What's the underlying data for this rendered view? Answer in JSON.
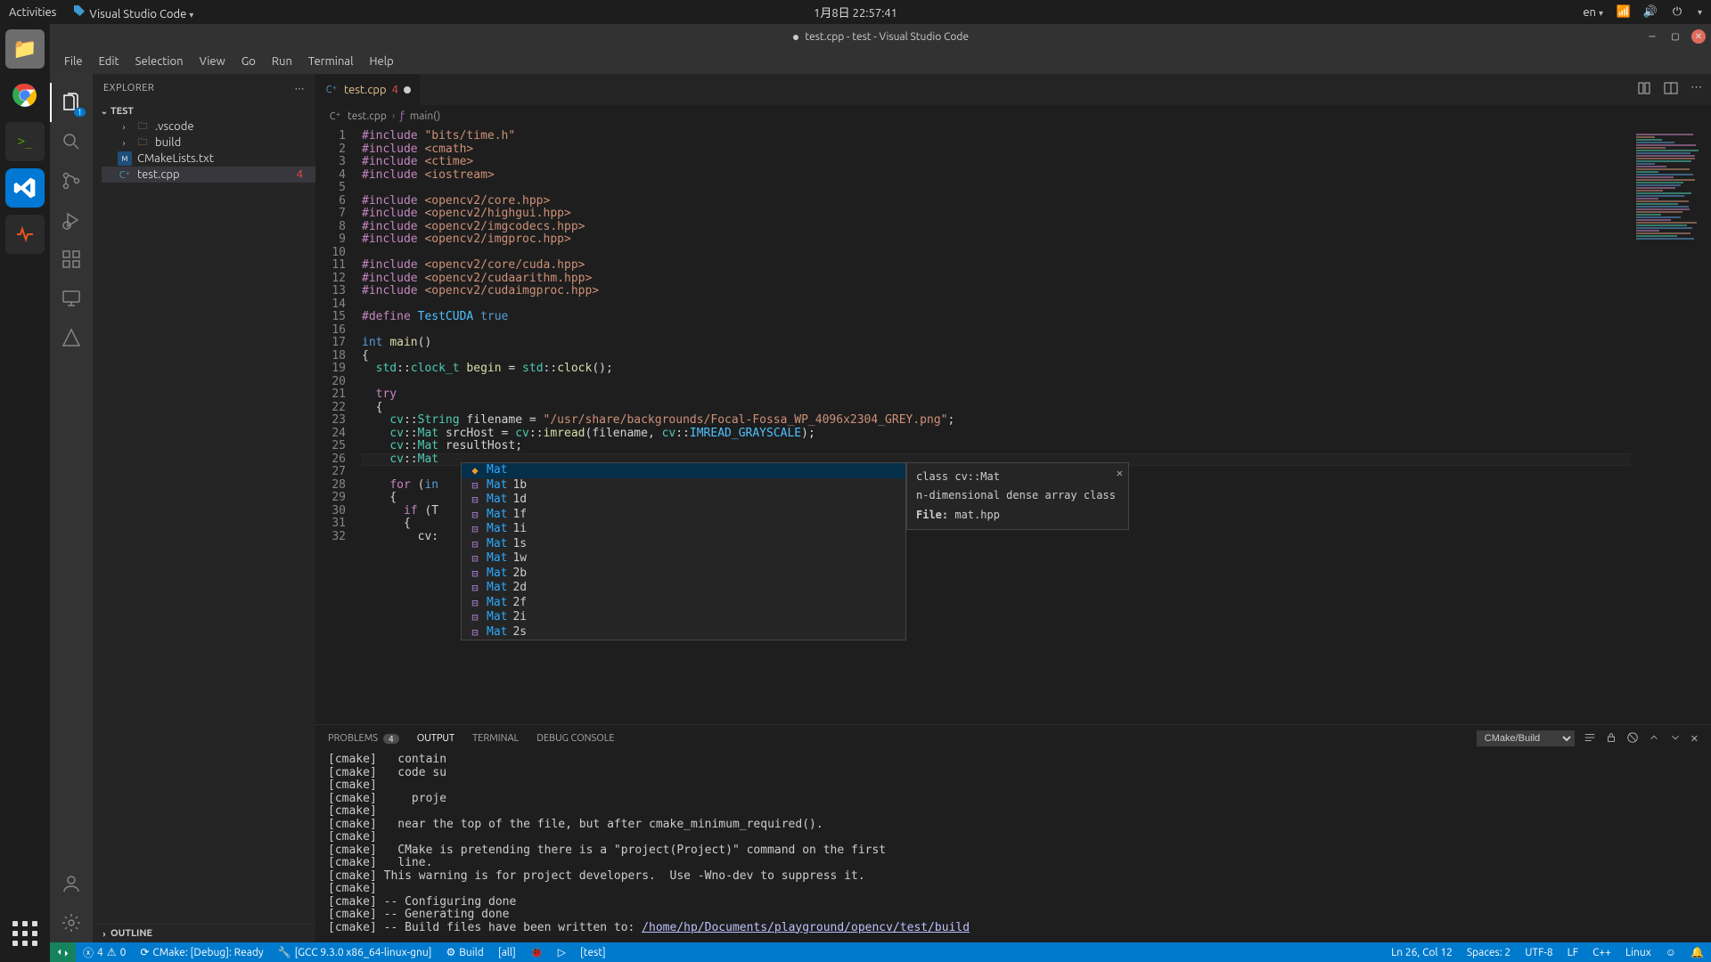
{
  "gnome": {
    "activities": "Activities",
    "app": "Visual Studio Code",
    "clock": "1月8日 22:57:41",
    "lang": "en"
  },
  "window": {
    "title_dirty": "●",
    "title": "test.cpp - test - Visual Studio Code"
  },
  "menu": [
    "File",
    "Edit",
    "Selection",
    "View",
    "Go",
    "Run",
    "Terminal",
    "Help"
  ],
  "sidebar": {
    "header": "EXPLORER",
    "project": "TEST",
    "items": [
      {
        "kind": "folder",
        "label": ".vscode"
      },
      {
        "kind": "folder",
        "label": "build"
      },
      {
        "kind": "cmake",
        "label": "CMakeLists.txt"
      },
      {
        "kind": "cpp",
        "label": "test.cpp",
        "err": "4",
        "selected": true
      }
    ],
    "outline": "OUTLINE"
  },
  "tab": {
    "name": "test.cpp",
    "count": "4"
  },
  "crumbs": {
    "file": "test.cpp",
    "symbol": "main()"
  },
  "code": {
    "lines": [
      {
        "n": 1,
        "html": "<span class='kw'>#include</span> <span class='str'>\"bits/time.h\"</span>"
      },
      {
        "n": 2,
        "html": "<span class='kw'>#include</span> <span class='str'>&lt;cmath&gt;</span>"
      },
      {
        "n": 3,
        "html": "<span class='kw'>#include</span> <span class='str'>&lt;ctime&gt;</span>"
      },
      {
        "n": 4,
        "html": "<span class='kw'>#include</span> <span class='str'>&lt;iostream&gt;</span>"
      },
      {
        "n": 5,
        "html": ""
      },
      {
        "n": 6,
        "html": "<span class='kw'>#include</span> <span class='str'>&lt;opencv2/core.hpp&gt;</span>"
      },
      {
        "n": 7,
        "html": "<span class='kw'>#include</span> <span class='str'>&lt;opencv2/highgui.hpp&gt;</span>"
      },
      {
        "n": 8,
        "html": "<span class='kw'>#include</span> <span class='str'>&lt;opencv2/imgcodecs.hpp&gt;</span>"
      },
      {
        "n": 9,
        "html": "<span class='kw'>#include</span> <span class='str'>&lt;opencv2/imgproc.hpp&gt;</span>"
      },
      {
        "n": 10,
        "html": ""
      },
      {
        "n": 11,
        "html": "<span class='kw'>#include</span> <span class='str'>&lt;opencv2/core/cuda.hpp&gt;</span>"
      },
      {
        "n": 12,
        "html": "<span class='kw'>#include</span> <span class='str'>&lt;opencv2/cudaarithm.hpp&gt;</span>"
      },
      {
        "n": 13,
        "html": "<span class='kw'>#include</span> <span class='str'>&lt;opencv2/cudaimgproc.hpp&gt;</span>"
      },
      {
        "n": 14,
        "html": ""
      },
      {
        "n": 15,
        "html": "<span class='kw'>#define</span> <span class='const'>TestCUDA</span> <span class='type'>true</span>"
      },
      {
        "n": 16,
        "html": ""
      },
      {
        "n": 17,
        "html": "<span class='type'>int</span> <span class='fn'>main</span>()"
      },
      {
        "n": 18,
        "html": "{"
      },
      {
        "n": 19,
        "html": "  <span class='cls'>std</span>::<span class='cls'>clock_t</span> <span class='fn'>begin</span> = <span class='cls'>std</span>::<span class='fn'>clock</span>();"
      },
      {
        "n": 20,
        "html": ""
      },
      {
        "n": 21,
        "html": "  <span class='kw'>try</span>"
      },
      {
        "n": 22,
        "html": "  {"
      },
      {
        "n": 23,
        "html": "    <span class='cls'>cv</span>::<span class='cls'>String</span> <span>filename</span> = <span class='str'>\"/usr/share/backgrounds/Focal-Fossa_WP_4096x2304_GREY.png\"</span>;"
      },
      {
        "n": 24,
        "html": "    <span class='cls'>cv</span>::<span class='cls'>Mat</span> <span>srcHost</span> = <span class='cls'>cv</span>::<span class='fn'>imread</span>(filename, <span class='cls'>cv</span>::<span class='const'>IMREAD_GRAYSCALE</span>);"
      },
      {
        "n": 25,
        "html": "    <span class='cls'>cv</span>::<span class='cls'>Mat</span> resultHost;"
      },
      {
        "n": 26,
        "html": "    <span class='cls'>cv</span>::<span class='cls'>Mat</span>"
      },
      {
        "n": 27,
        "html": ""
      },
      {
        "n": 28,
        "html": "    <span class='kw'>for</span> (<span class='type'>in</span>"
      },
      {
        "n": 29,
        "html": "    {"
      },
      {
        "n": 30,
        "html": "      <span class='kw'>if</span> (T"
      },
      {
        "n": 31,
        "html": "      {"
      },
      {
        "n": 32,
        "html": "        cv:"
      }
    ],
    "current": 26
  },
  "suggest": {
    "items": [
      {
        "match": "Mat",
        "rest": ""
      },
      {
        "match": "Mat",
        "rest": "1b"
      },
      {
        "match": "Mat",
        "rest": "1d"
      },
      {
        "match": "Mat",
        "rest": "1f"
      },
      {
        "match": "Mat",
        "rest": "1i"
      },
      {
        "match": "Mat",
        "rest": "1s"
      },
      {
        "match": "Mat",
        "rest": "1w"
      },
      {
        "match": "Mat",
        "rest": "2b"
      },
      {
        "match": "Mat",
        "rest": "2d"
      },
      {
        "match": "Mat",
        "rest": "2f"
      },
      {
        "match": "Mat",
        "rest": "2i"
      },
      {
        "match": "Mat",
        "rest": "2s"
      }
    ]
  },
  "doc": {
    "sig": "class cv::Mat",
    "desc": "n-dimensional dense array class",
    "file_label": "File:",
    "file": "mat.hpp"
  },
  "panel": {
    "tabs": {
      "problems": "PROBLEMS",
      "problems_n": "4",
      "output": "OUTPUT",
      "terminal": "TERMINAL",
      "debug": "DEBUG CONSOLE"
    },
    "channel": "CMake/Build",
    "lines": [
      "[cmake]   contain",
      "[cmake]   code su",
      "[cmake] ",
      "[cmake]     proje",
      "[cmake] ",
      "[cmake]   near the top of the file, but after cmake_minimum_required().",
      "[cmake] ",
      "[cmake]   CMake is pretending there is a \"project(Project)\" command on the first",
      "[cmake]   line.",
      "[cmake] This warning is for project developers.  Use -Wno-dev to suppress it.",
      "[cmake] ",
      "[cmake] -- Configuring done",
      "[cmake] -- Generating done"
    ],
    "last_prefix": "[cmake] -- Build files have been written to: ",
    "last_path": "/home/hp/Documents/playground/opencv/test/build"
  },
  "status": {
    "errors": "4",
    "warnings": "0",
    "cmake": "CMake: [Debug]: Ready",
    "kit": "[GCC 9.3.0 x86_64-linux-gnu]",
    "build": "Build",
    "target": "[all]",
    "launch": "[test]",
    "pos": "Ln 26, Col 12",
    "spaces": "Spaces: 2",
    "enc": "UTF-8",
    "eol": "LF",
    "lang": "C++",
    "os": "Linux"
  }
}
